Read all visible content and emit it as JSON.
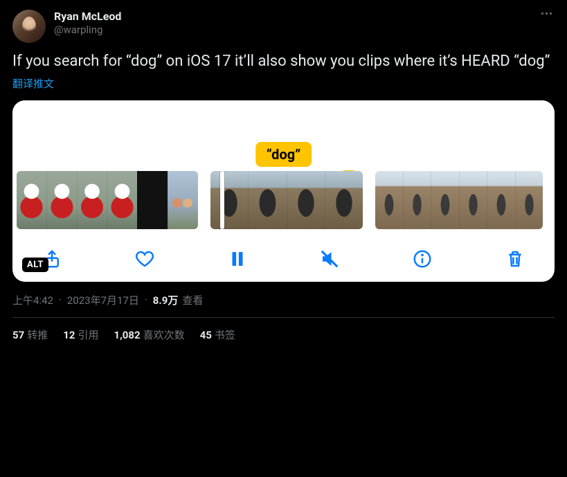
{
  "author": {
    "display_name": "Ryan McLeod",
    "handle": "@warpling"
  },
  "tweet_text": "If you search for “dog” on iOS 17 it’ll also show you clips where it’s HEARD “dog”",
  "translate_label": "翻译推文",
  "media": {
    "search_chip": "“dog”",
    "alt_badge": "ALT",
    "toolbar_icons": [
      "share",
      "heart",
      "pause",
      "mute",
      "info",
      "trash"
    ]
  },
  "meta": {
    "time": "上午4:42",
    "date": "2023年7月17日",
    "views_count": "8.9万",
    "views_label": "查看"
  },
  "stats": {
    "retweets_count": "57",
    "retweets_label": "转推",
    "quotes_count": "12",
    "quotes_label": "引用",
    "likes_count": "1,082",
    "likes_label": "喜欢次数",
    "bookmarks_count": "45",
    "bookmarks_label": "书签"
  }
}
